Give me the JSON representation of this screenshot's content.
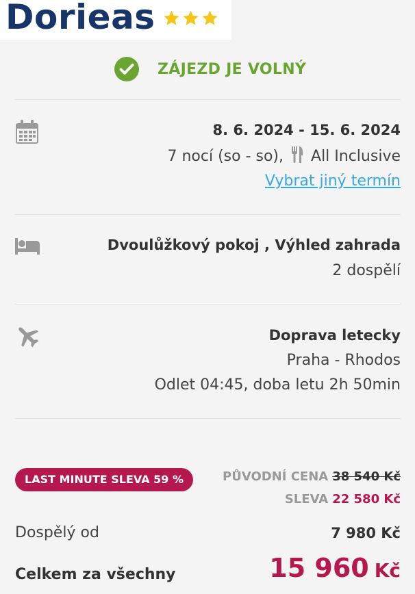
{
  "hotel": {
    "name": "Dorieas",
    "stars": 3
  },
  "status": {
    "text": "ZÁJEZD JE VOLNÝ"
  },
  "term": {
    "dates": "8. 6. 2024 - 15. 6. 2024",
    "nights": "7 nocí (so - so),",
    "board": "All Inclusive",
    "change_link": "Vybrat jiný termín"
  },
  "room": {
    "type": "Dvoulůžkový pokoj , Výhled zahrada",
    "occupancy": "2 dospělí"
  },
  "transport": {
    "title": "Doprava letecky",
    "route": "Praha - Rhodos",
    "details": "Odlet 04:45, doba letu 2h 50min"
  },
  "pricing": {
    "badge": "LAST MINUTE SLEVA 59 %",
    "original_label": "PŮVODNÍ CENA",
    "original_price": "38 540 Kč",
    "discount_label": "SLEVA",
    "discount_price": "22 580 Kč",
    "adult_label": "Dospělý od",
    "adult_price": "7 980 Kč",
    "total_label": "Celkem za všechny",
    "total_amount": "15 960",
    "total_currency": "Kč"
  },
  "colors": {
    "brand": "#17356b",
    "ok": "#6aa431",
    "accent": "#b5174f",
    "link": "#37a8e1",
    "star": "#f5c518"
  },
  "icons": [
    "star-icon",
    "check-circle-icon",
    "calendar-icon",
    "cutlery-icon",
    "bed-icon",
    "plane-icon"
  ]
}
